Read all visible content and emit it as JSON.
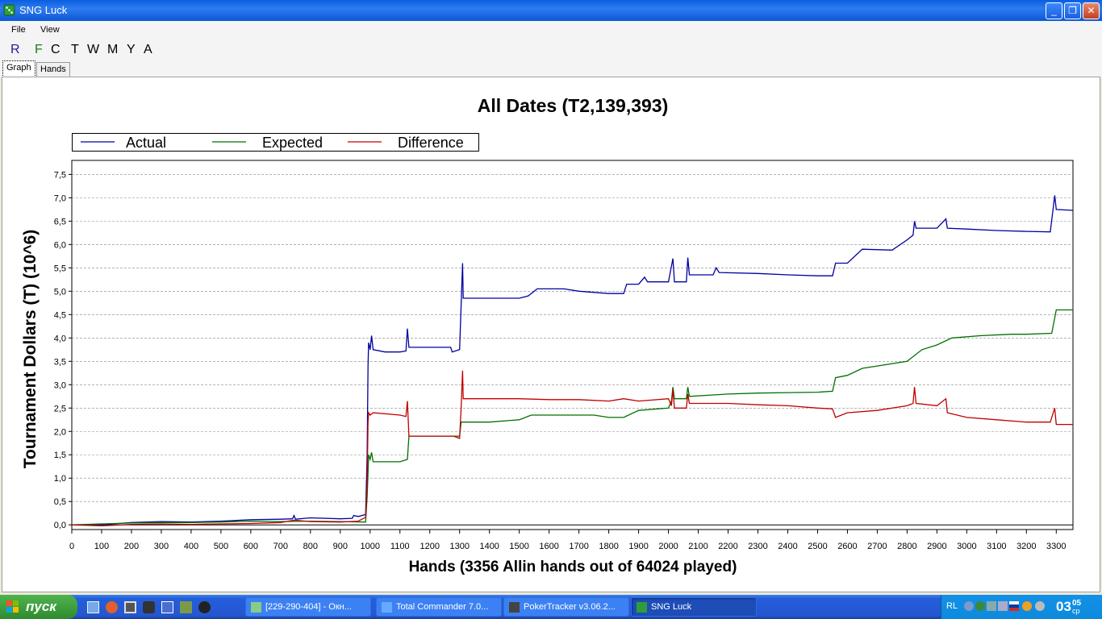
{
  "window": {
    "title": "SNG Luck",
    "minimize": "_",
    "maximize": "❐",
    "close": "✕"
  },
  "menu": {
    "file": "File",
    "view": "View"
  },
  "toolbar": [
    {
      "label": "R",
      "color": "#1c1c9c"
    },
    {
      "label": "F",
      "color": "#1c7c1c"
    },
    {
      "label": "C",
      "color": "#000000"
    },
    {
      "label": "T",
      "color": "#000000"
    },
    {
      "label": "W",
      "color": "#000000"
    },
    {
      "label": "M",
      "color": "#000000"
    },
    {
      "label": "Y",
      "color": "#000000"
    },
    {
      "label": "A",
      "color": "#000000"
    }
  ],
  "tabs": {
    "graph": "Graph",
    "hands": "Hands"
  },
  "chart_data": {
    "type": "line",
    "title": "All Dates (T2,139,393)",
    "xlabel": "Hands (3356 Allin hands out of 64024 played)",
    "ylabel": "Tournament Dollars (T) (10^6)",
    "xlim": [
      0,
      3356
    ],
    "ylim": [
      -0.1,
      7.8
    ],
    "x_ticks": [
      "0",
      "100",
      "200",
      "300",
      "400",
      "500",
      "600",
      "700",
      "800",
      "900",
      "1000",
      "1100",
      "1200",
      "1300",
      "1400",
      "1500",
      "1600",
      "1700",
      "1800",
      "1900",
      "2000",
      "2100",
      "2200",
      "2300",
      "2400",
      "2500",
      "2600",
      "2700",
      "2800",
      "2900",
      "3000",
      "3100",
      "3200",
      "3300"
    ],
    "y_ticks": [
      "0,0",
      "0,5",
      "1,0",
      "1,5",
      "2,0",
      "2,5",
      "3,0",
      "3,5",
      "4,0",
      "4,5",
      "5,0",
      "5,5",
      "6,0",
      "6,5",
      "7,0",
      "7,5"
    ],
    "grid": true,
    "legend": "top-left",
    "series": [
      {
        "name": "Actual",
        "color": "#0000a0",
        "points": [
          [
            0,
            0.0
          ],
          [
            100,
            0.0
          ],
          [
            200,
            0.05
          ],
          [
            300,
            0.07
          ],
          [
            400,
            0.06
          ],
          [
            500,
            0.08
          ],
          [
            600,
            0.11
          ],
          [
            700,
            0.12
          ],
          [
            740,
            0.13
          ],
          [
            745,
            0.2
          ],
          [
            750,
            0.12
          ],
          [
            800,
            0.15
          ],
          [
            900,
            0.13
          ],
          [
            940,
            0.14
          ],
          [
            945,
            0.2
          ],
          [
            960,
            0.18
          ],
          [
            985,
            0.22
          ],
          [
            990,
            1.5
          ],
          [
            993,
            3.4
          ],
          [
            995,
            3.9
          ],
          [
            1000,
            3.75
          ],
          [
            1005,
            4.05
          ],
          [
            1010,
            3.75
          ],
          [
            1050,
            3.7
          ],
          [
            1100,
            3.7
          ],
          [
            1120,
            3.72
          ],
          [
            1125,
            4.2
          ],
          [
            1130,
            3.8
          ],
          [
            1200,
            3.8
          ],
          [
            1270,
            3.8
          ],
          [
            1275,
            3.7
          ],
          [
            1300,
            3.75
          ],
          [
            1305,
            4.7
          ],
          [
            1310,
            5.6
          ],
          [
            1312,
            4.85
          ],
          [
            1400,
            4.85
          ],
          [
            1500,
            4.85
          ],
          [
            1530,
            4.9
          ],
          [
            1560,
            5.05
          ],
          [
            1650,
            5.05
          ],
          [
            1700,
            5.0
          ],
          [
            1800,
            4.95
          ],
          [
            1850,
            4.95
          ],
          [
            1860,
            5.15
          ],
          [
            1900,
            5.15
          ],
          [
            1920,
            5.3
          ],
          [
            1930,
            5.2
          ],
          [
            2000,
            5.2
          ],
          [
            2015,
            5.7
          ],
          [
            2020,
            5.2
          ],
          [
            2060,
            5.2
          ],
          [
            2065,
            5.72
          ],
          [
            2070,
            5.35
          ],
          [
            2150,
            5.35
          ],
          [
            2160,
            5.5
          ],
          [
            2170,
            5.4
          ],
          [
            2300,
            5.38
          ],
          [
            2400,
            5.35
          ],
          [
            2500,
            5.33
          ],
          [
            2550,
            5.33
          ],
          [
            2560,
            5.6
          ],
          [
            2600,
            5.6
          ],
          [
            2650,
            5.9
          ],
          [
            2750,
            5.88
          ],
          [
            2800,
            6.1
          ],
          [
            2820,
            6.2
          ],
          [
            2825,
            6.5
          ],
          [
            2830,
            6.35
          ],
          [
            2900,
            6.35
          ],
          [
            2930,
            6.55
          ],
          [
            2935,
            6.35
          ],
          [
            3000,
            6.33
          ],
          [
            3100,
            6.3
          ],
          [
            3200,
            6.28
          ],
          [
            3280,
            6.27
          ],
          [
            3295,
            7.05
          ],
          [
            3300,
            6.75
          ],
          [
            3356,
            6.73
          ]
        ]
      },
      {
        "name": "Expected",
        "color": "#007000",
        "points": [
          [
            0,
            0.0
          ],
          [
            100,
            0.02
          ],
          [
            200,
            0.04
          ],
          [
            300,
            0.05
          ],
          [
            400,
            0.05
          ],
          [
            500,
            0.06
          ],
          [
            600,
            0.08
          ],
          [
            700,
            0.07
          ],
          [
            800,
            0.08
          ],
          [
            900,
            0.07
          ],
          [
            985,
            0.06
          ],
          [
            990,
            0.6
          ],
          [
            993,
            1.1
          ],
          [
            995,
            1.5
          ],
          [
            1000,
            1.4
          ],
          [
            1005,
            1.55
          ],
          [
            1010,
            1.35
          ],
          [
            1100,
            1.35
          ],
          [
            1125,
            1.4
          ],
          [
            1130,
            1.9
          ],
          [
            1200,
            1.9
          ],
          [
            1280,
            1.9
          ],
          [
            1300,
            1.9
          ],
          [
            1305,
            2.2
          ],
          [
            1400,
            2.2
          ],
          [
            1500,
            2.25
          ],
          [
            1540,
            2.35
          ],
          [
            1650,
            2.35
          ],
          [
            1750,
            2.35
          ],
          [
            1800,
            2.3
          ],
          [
            1850,
            2.3
          ],
          [
            1900,
            2.45
          ],
          [
            2000,
            2.5
          ],
          [
            2010,
            2.65
          ],
          [
            2015,
            2.95
          ],
          [
            2020,
            2.7
          ],
          [
            2060,
            2.7
          ],
          [
            2065,
            2.95
          ],
          [
            2070,
            2.75
          ],
          [
            2200,
            2.8
          ],
          [
            2300,
            2.82
          ],
          [
            2400,
            2.83
          ],
          [
            2500,
            2.84
          ],
          [
            2550,
            2.86
          ],
          [
            2560,
            3.15
          ],
          [
            2600,
            3.2
          ],
          [
            2650,
            3.35
          ],
          [
            2700,
            3.4
          ],
          [
            2800,
            3.5
          ],
          [
            2850,
            3.75
          ],
          [
            2900,
            3.85
          ],
          [
            2950,
            4.0
          ],
          [
            3050,
            4.05
          ],
          [
            3150,
            4.08
          ],
          [
            3200,
            4.08
          ],
          [
            3285,
            4.1
          ],
          [
            3300,
            4.6
          ],
          [
            3356,
            4.6
          ]
        ]
      },
      {
        "name": "Difference",
        "color": "#c00000",
        "points": [
          [
            0,
            0.0
          ],
          [
            100,
            -0.02
          ],
          [
            200,
            0.01
          ],
          [
            300,
            0.02
          ],
          [
            400,
            0.01
          ],
          [
            500,
            0.02
          ],
          [
            600,
            0.03
          ],
          [
            700,
            0.05
          ],
          [
            745,
            0.1
          ],
          [
            800,
            0.07
          ],
          [
            900,
            0.06
          ],
          [
            960,
            0.08
          ],
          [
            985,
            0.16
          ],
          [
            990,
            0.9
          ],
          [
            993,
            2.2
          ],
          [
            995,
            2.4
          ],
          [
            1000,
            2.35
          ],
          [
            1010,
            2.4
          ],
          [
            1100,
            2.35
          ],
          [
            1120,
            2.32
          ],
          [
            1125,
            2.65
          ],
          [
            1130,
            1.9
          ],
          [
            1200,
            1.9
          ],
          [
            1280,
            1.9
          ],
          [
            1300,
            1.85
          ],
          [
            1305,
            2.5
          ],
          [
            1310,
            3.3
          ],
          [
            1312,
            2.7
          ],
          [
            1400,
            2.7
          ],
          [
            1500,
            2.7
          ],
          [
            1600,
            2.68
          ],
          [
            1700,
            2.68
          ],
          [
            1800,
            2.65
          ],
          [
            1850,
            2.7
          ],
          [
            1900,
            2.65
          ],
          [
            2000,
            2.7
          ],
          [
            2010,
            2.55
          ],
          [
            2015,
            2.9
          ],
          [
            2020,
            2.5
          ],
          [
            2060,
            2.5
          ],
          [
            2065,
            2.8
          ],
          [
            2070,
            2.6
          ],
          [
            2200,
            2.6
          ],
          [
            2300,
            2.57
          ],
          [
            2400,
            2.55
          ],
          [
            2500,
            2.5
          ],
          [
            2550,
            2.48
          ],
          [
            2560,
            2.3
          ],
          [
            2600,
            2.4
          ],
          [
            2700,
            2.45
          ],
          [
            2800,
            2.55
          ],
          [
            2820,
            2.6
          ],
          [
            2825,
            2.95
          ],
          [
            2830,
            2.6
          ],
          [
            2900,
            2.55
          ],
          [
            2930,
            2.7
          ],
          [
            2935,
            2.4
          ],
          [
            3000,
            2.3
          ],
          [
            3100,
            2.25
          ],
          [
            3200,
            2.2
          ],
          [
            3280,
            2.2
          ],
          [
            3295,
            2.5
          ],
          [
            3300,
            2.15
          ],
          [
            3356,
            2.15
          ]
        ]
      }
    ]
  },
  "taskbar": {
    "start": "пуск",
    "tasks": [
      {
        "label": "[229-290-404] - Окн...",
        "active": false
      },
      {
        "label": "Total Commander 7.0...",
        "active": false
      },
      {
        "label": "PokerTracker v3.06.2...",
        "active": false
      },
      {
        "label": "SNG Luck",
        "active": true
      }
    ],
    "tray_lang": "RL",
    "clock_hh": "03",
    "clock_mm": "05",
    "clock_day": "ср"
  }
}
